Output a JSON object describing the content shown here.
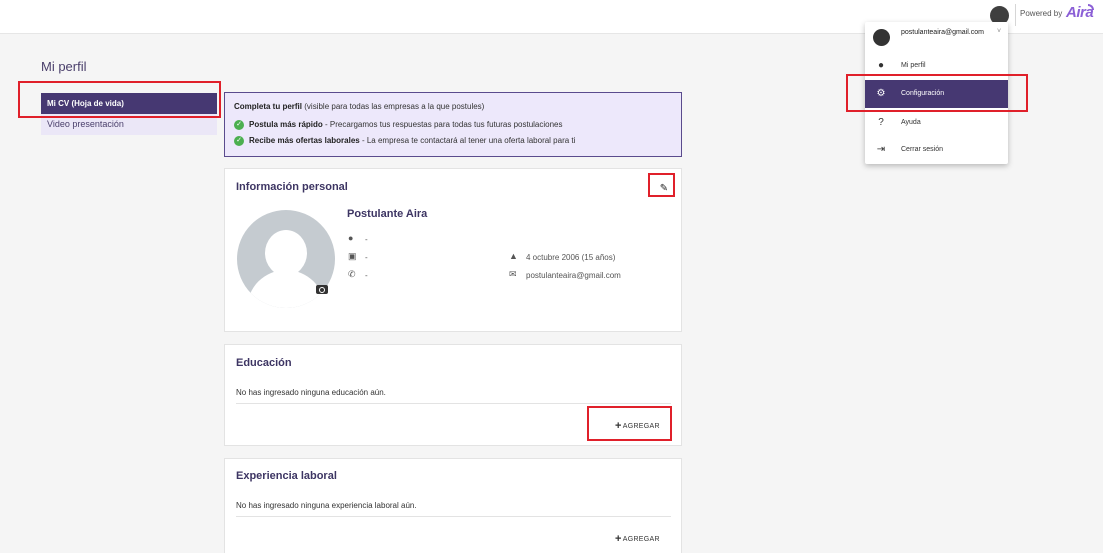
{
  "header": {
    "powered_by": "Powered by",
    "brand": "Aira"
  },
  "page": {
    "title": "Mi perfil"
  },
  "sidebar": {
    "items": [
      {
        "label": "Mi CV (Hoja de vida)",
        "active": true
      },
      {
        "label": "Video presentación",
        "active": false
      }
    ]
  },
  "banner": {
    "heading": "Completa tu perfil",
    "heading_note": "(visible para todas las empresas a la que postules)",
    "rows": [
      {
        "bold": "Postula más rápido",
        "text": "- Precargamos tus respuestas para todas tus futuras postulaciones"
      },
      {
        "bold": "Recibe más ofertas laborales",
        "text": "- La empresa te contactará al tener una oferta laboral para ti"
      }
    ]
  },
  "personal": {
    "title": "Información personal",
    "name": "Postulante Aira",
    "location": "-",
    "document": "-",
    "phone": "-",
    "birthday": "4 octubre 2006 (15 años)",
    "email": "postulanteaira@gmail.com"
  },
  "education": {
    "title": "Educación",
    "empty": "No has ingresado ninguna educación aún.",
    "add_label": "AGREGAR"
  },
  "experience": {
    "title": "Experiencia laboral",
    "empty": "No has ingresado ninguna experiencia laboral aún.",
    "add_label": "AGREGAR"
  },
  "user_menu": {
    "email": "postulanteaira@gmail.com",
    "items": [
      {
        "label": "Mi perfil",
        "icon": "person-icon",
        "active": false
      },
      {
        "label": "Configuración",
        "icon": "gear-icon",
        "active": true
      },
      {
        "label": "Ayuda",
        "icon": "help-icon",
        "active": false
      },
      {
        "label": "Cerrar sesión",
        "icon": "logout-icon",
        "active": false
      }
    ]
  },
  "colors": {
    "accent": "#463872",
    "highlight": "#e0202a",
    "success": "#4caf50"
  }
}
